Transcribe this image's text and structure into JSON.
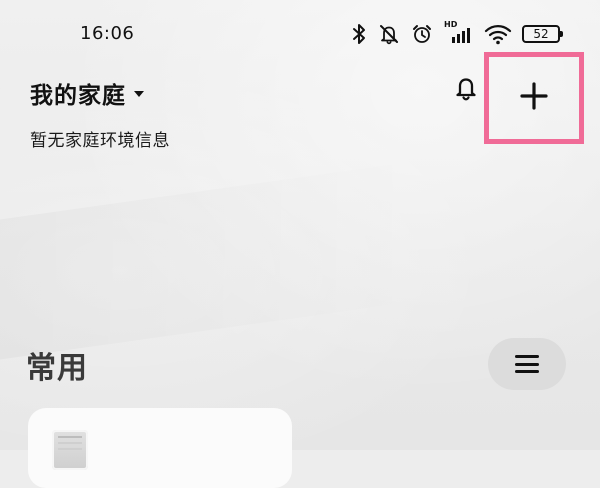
{
  "status_bar": {
    "time": "16:06",
    "battery_level": "52",
    "network_label": "HD",
    "icons": [
      "bluetooth-icon",
      "bell-muted-icon",
      "alarm-icon",
      "hd-signal-icon",
      "wifi-icon",
      "battery-icon"
    ]
  },
  "header": {
    "home_name": "我的家庭",
    "env_info": "暂无家庭环境信息",
    "notification_icon": "bell-icon",
    "add_icon": "plus-icon",
    "highlight_color": "#f06b97"
  },
  "common": {
    "title": "常用",
    "menu_icon": "menu-icon"
  },
  "device_card": {
    "thumbnail_icon": "device-thumbnail"
  }
}
